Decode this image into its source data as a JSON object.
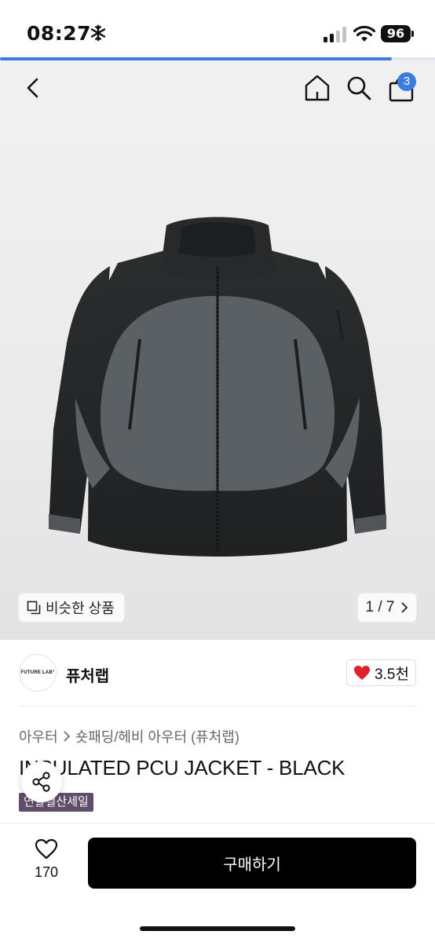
{
  "status_bar": {
    "time": "08:27",
    "battery": "96"
  },
  "page_progress": 0.9,
  "nav": {
    "cart_count": "3"
  },
  "gallery": {
    "similar_label": "비슷한 상품",
    "pager": "1 / 7"
  },
  "shop": {
    "logo_text": "FUTURE LAB°",
    "name": "퓨처랩",
    "likes": "3.5천"
  },
  "breadcrumb": {
    "category": "아우터",
    "subcategory": "숏패딩/헤비 아우터 (퓨처랩)"
  },
  "product": {
    "title": "INSULATED PCU JACKET - BLACK",
    "badge": "연말결산세일"
  },
  "bottom": {
    "wish_count": "170",
    "buy_label": "구매하기"
  },
  "colors": {
    "accent": "#3d7be0",
    "badge": "#5f4e6a",
    "heart": "#e0202a"
  }
}
